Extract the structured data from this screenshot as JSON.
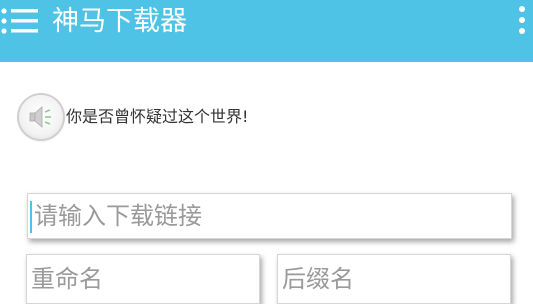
{
  "app_bar": {
    "title": "神马下载器",
    "background_color": "#4fc3e6",
    "menu_icon": "hamburger-menu-icon",
    "overflow_icon": "vertical-dots-icon"
  },
  "notice": {
    "icon": "speaker-icon",
    "text": "你是否曾怀疑过这个世界!"
  },
  "form": {
    "url_placeholder": "请输入下载链接",
    "url_value": "",
    "rename_placeholder": "重命名",
    "rename_value": "",
    "suffix_placeholder": "后缀名",
    "suffix_value": ""
  }
}
